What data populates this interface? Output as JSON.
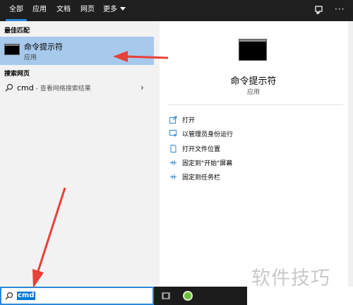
{
  "tabs": [
    {
      "label": "全部",
      "active": true
    },
    {
      "label": "应用",
      "active": false
    },
    {
      "label": "文档",
      "active": false
    },
    {
      "label": "网页",
      "active": false
    },
    {
      "label": "更多",
      "active": false
    }
  ],
  "left": {
    "best_match_header": "最佳匹配",
    "best_match": {
      "title": "命令提示符",
      "subtitle": "应用"
    },
    "web_header": "搜索网页",
    "web_result": {
      "query": "cmd",
      "desc": " - 查看网络搜索结果"
    }
  },
  "right": {
    "app_title": "命令提示符",
    "app_subtitle": "应用",
    "actions": [
      {
        "label": "打开",
        "icon": "open-icon"
      },
      {
        "label": "以管理员身份运行",
        "icon": "admin-icon"
      },
      {
        "label": "打开文件位置",
        "icon": "file-location-icon"
      },
      {
        "label": "固定到\"开始\"屏幕",
        "icon": "pin-icon"
      },
      {
        "label": "固定到任务栏",
        "icon": "pin-icon"
      }
    ]
  },
  "search": {
    "value": "cmd"
  },
  "watermark": "软件技巧",
  "colors": {
    "accent": "#2b88d8",
    "selected_bg": "#a6c9ec",
    "annotation_arrow": "#e8403a"
  }
}
